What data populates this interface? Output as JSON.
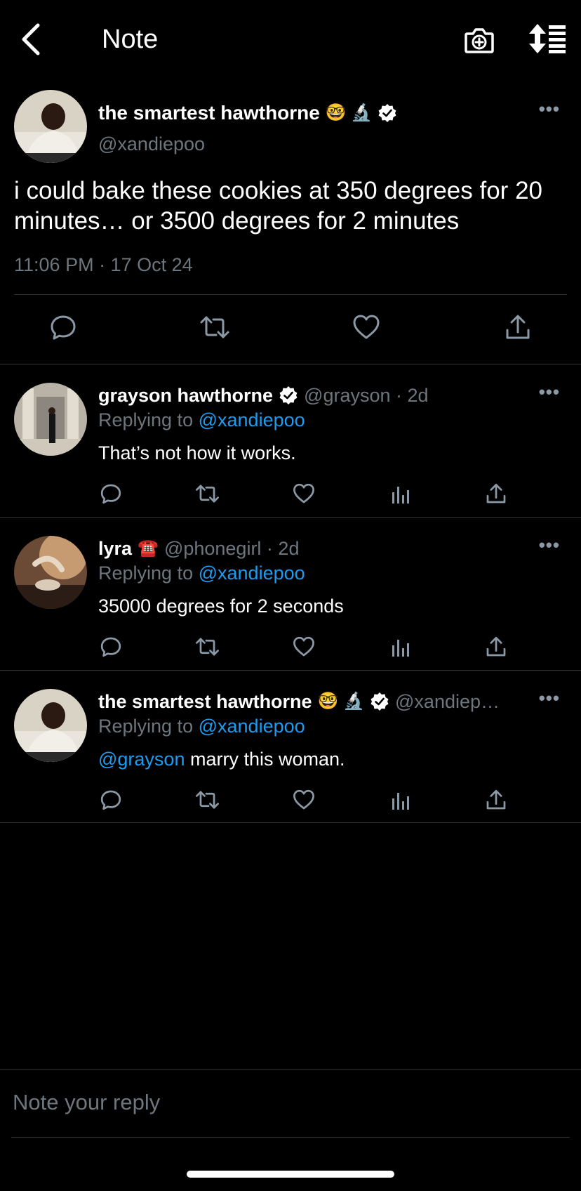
{
  "header": {
    "title": "Note",
    "back_icon": "chevron-left-icon",
    "camera_icon": "camera-plus-icon",
    "sort_icon": "sort-list-icon"
  },
  "main_note": {
    "name": "the smartest hawthorne",
    "emoji": "🤓 🔬",
    "verified": true,
    "handle": "@xandiepoo",
    "text": "i could bake these cookies at 350 degrees for 20 minutes… or 3500 degrees for 2 minutes",
    "timestamp": "11:06 PM · 17 Oct 24",
    "more": "•••"
  },
  "replies": [
    {
      "name": "grayson hawthorne",
      "emoji": "",
      "verified": true,
      "meta": "@grayson · 2d",
      "replying_prefix": "Replying to",
      "replying_to": "@xandiepoo",
      "mention": "",
      "text": "That’s not how it works.",
      "more": "•••"
    },
    {
      "name": "lyra",
      "emoji": "☎️",
      "verified": false,
      "meta": "@phonegirl · 2d",
      "replying_prefix": "Replying to",
      "replying_to": "@xandiepoo",
      "mention": "",
      "text": "35000 degrees for 2 seconds",
      "more": "•••"
    },
    {
      "name": "the smartest hawthorne",
      "emoji": "🤓 🔬",
      "verified": true,
      "meta": "@xandiep…",
      "replying_prefix": "Replying to",
      "replying_to": "@xandiepoo",
      "mention": "@grayson",
      "text": " marry this woman.",
      "more": "•••"
    }
  ],
  "compose": {
    "placeholder": "Note your reply"
  },
  "colors": {
    "background": "#000000",
    "text": "#ffffff",
    "muted": "#6e767d",
    "accent": "#1d9bf0",
    "divider": "#2f3336"
  }
}
